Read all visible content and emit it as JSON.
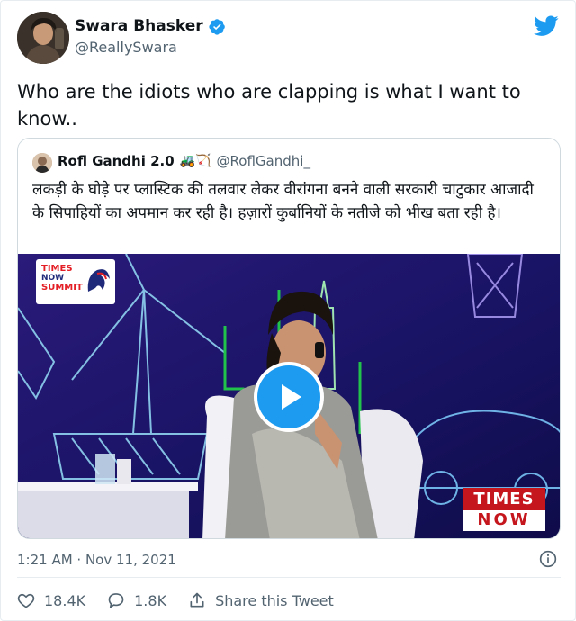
{
  "author": {
    "display_name": "Swara Bhasker",
    "handle": "@ReallySwara",
    "verified": true
  },
  "tweet": {
    "text": "Who are the idiots who are clapping is what I want to know.."
  },
  "quoted_tweet": {
    "display_name": "Rofl Gandhi 2.0",
    "emojis": "🚜🏹",
    "handle": "@RoflGandhi_",
    "text": "लकड़ी के घोड़े पर प्लास्टिक की तलवार लेकर वीरांगना बनने वाली सरकारी चाटुकार आजादी के सिपाहियों का अपमान कर रही है। हज़ारों कुर्बानियों के नतीजे को भीख बता रही है।",
    "video": {
      "logo_lines": [
        "TIMES",
        "NOW",
        "SUMMIT"
      ],
      "channel_top": "TIMES",
      "channel_bottom": "NOW"
    }
  },
  "meta": {
    "timestamp": "1:21 AM · Nov 11, 2021"
  },
  "actions": {
    "likes": "18.4K",
    "replies": "1.8K",
    "share_label": "Share this Tweet"
  },
  "colors": {
    "accent": "#1d9bf0",
    "text": "#0f1419",
    "muted": "#536471",
    "border": "#cfd9de"
  }
}
